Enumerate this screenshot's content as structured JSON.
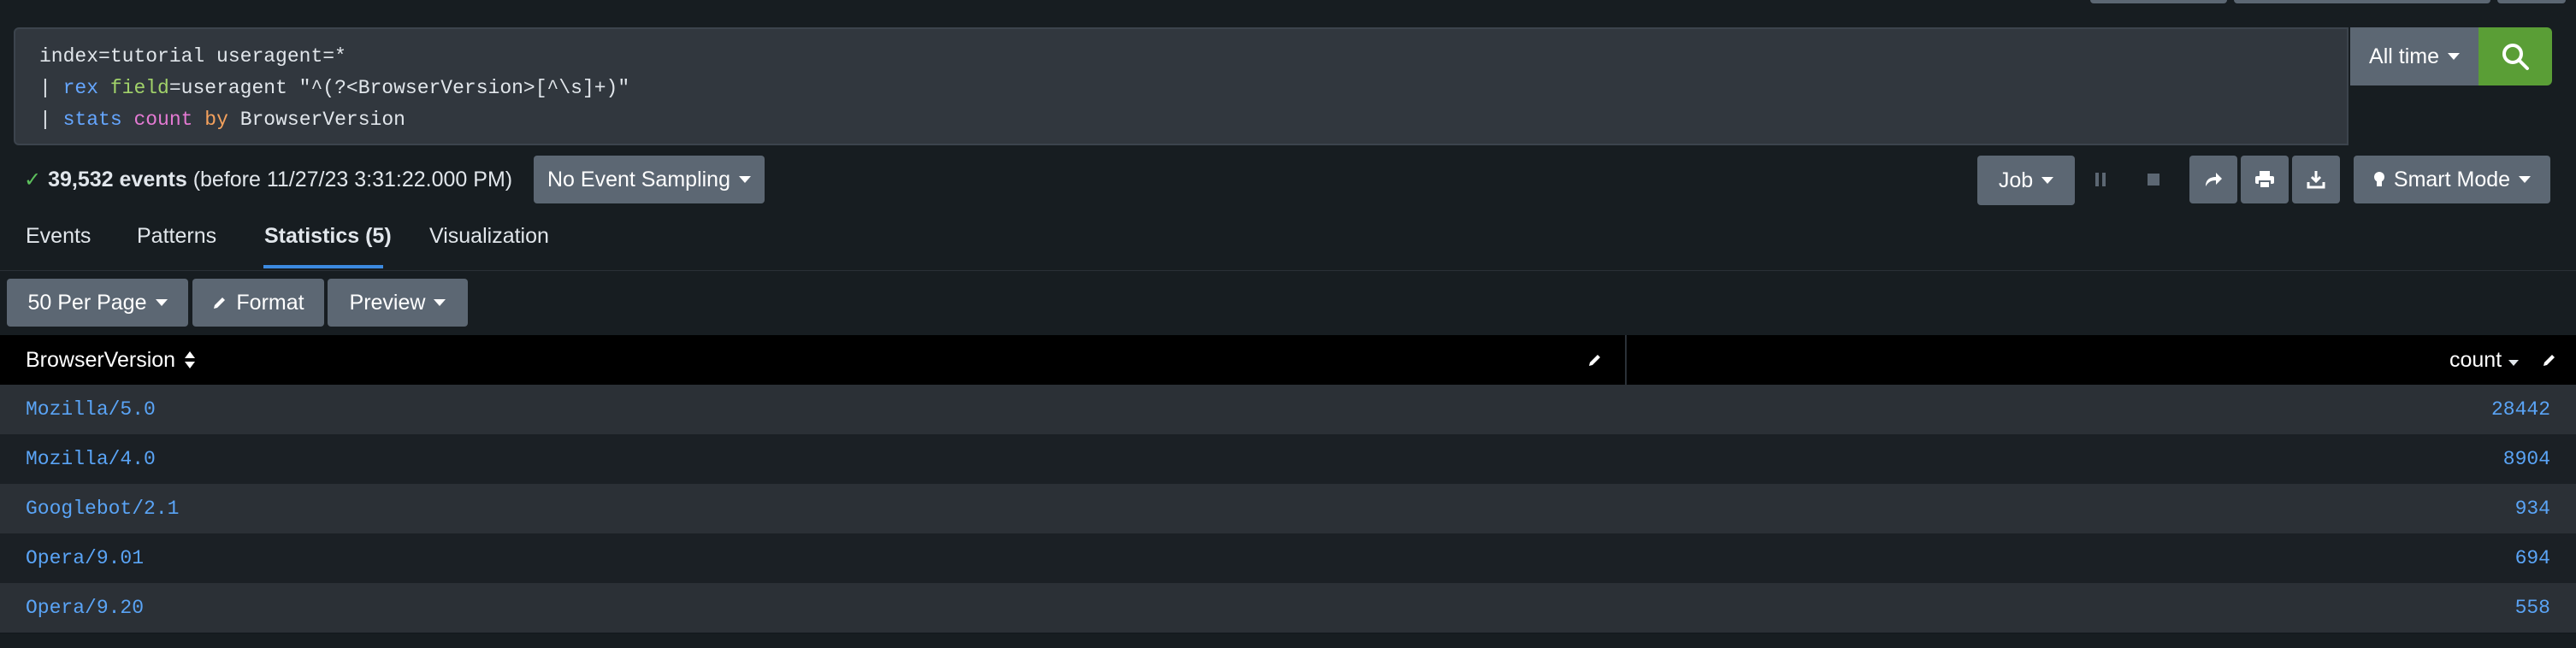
{
  "search": {
    "line1": "index=tutorial useragent=*",
    "line2_pipe": "| ",
    "line2_cmd": "rex",
    "line2_arg": "field",
    "line2_rest": "=useragent \"^(?<BrowserVersion>[^\\s]+)\"",
    "line3_pipe": "| ",
    "line3_cmd": "stats",
    "line3_fn": "count",
    "line3_by": "by",
    "line3_field": "BrowserVersion",
    "time_range_label": "All time"
  },
  "status": {
    "count": "39,532 events",
    "detail": "(before 11/27/23 3:31:22.000 PM)",
    "sampling_label": "No Event Sampling"
  },
  "toolbar": {
    "job_label": "Job",
    "mode_label": "Smart Mode"
  },
  "tabs": [
    {
      "label": "Events",
      "active": false
    },
    {
      "label": "Patterns",
      "active": false
    },
    {
      "label": "Statistics (5)",
      "active": true
    },
    {
      "label": "Visualization",
      "active": false
    }
  ],
  "controls": {
    "per_page_label": "50 Per Page",
    "format_label": "Format",
    "preview_label": "Preview"
  },
  "table": {
    "columns": [
      "BrowserVersion",
      "count"
    ],
    "rows": [
      {
        "browser": "Mozilla/5.0",
        "count": "28442"
      },
      {
        "browser": "Mozilla/4.0",
        "count": "8904"
      },
      {
        "browser": "Googlebot/2.1",
        "count": "934"
      },
      {
        "browser": "Opera/9.01",
        "count": "694"
      },
      {
        "browser": "Opera/9.20",
        "count": "558"
      }
    ]
  },
  "colors": {
    "background": "#171d21",
    "accent_tab": "#3c8ae0",
    "search_button": "#5a9e36",
    "link_value": "#5aa4f6",
    "button": "#5c6773"
  },
  "icons": [
    "search-icon",
    "checkmark-icon",
    "pause-icon",
    "stop-icon",
    "share-icon",
    "print-icon",
    "export-icon",
    "lightbulb-icon",
    "pencil-icon",
    "sort-icon",
    "sort-desc-icon"
  ]
}
